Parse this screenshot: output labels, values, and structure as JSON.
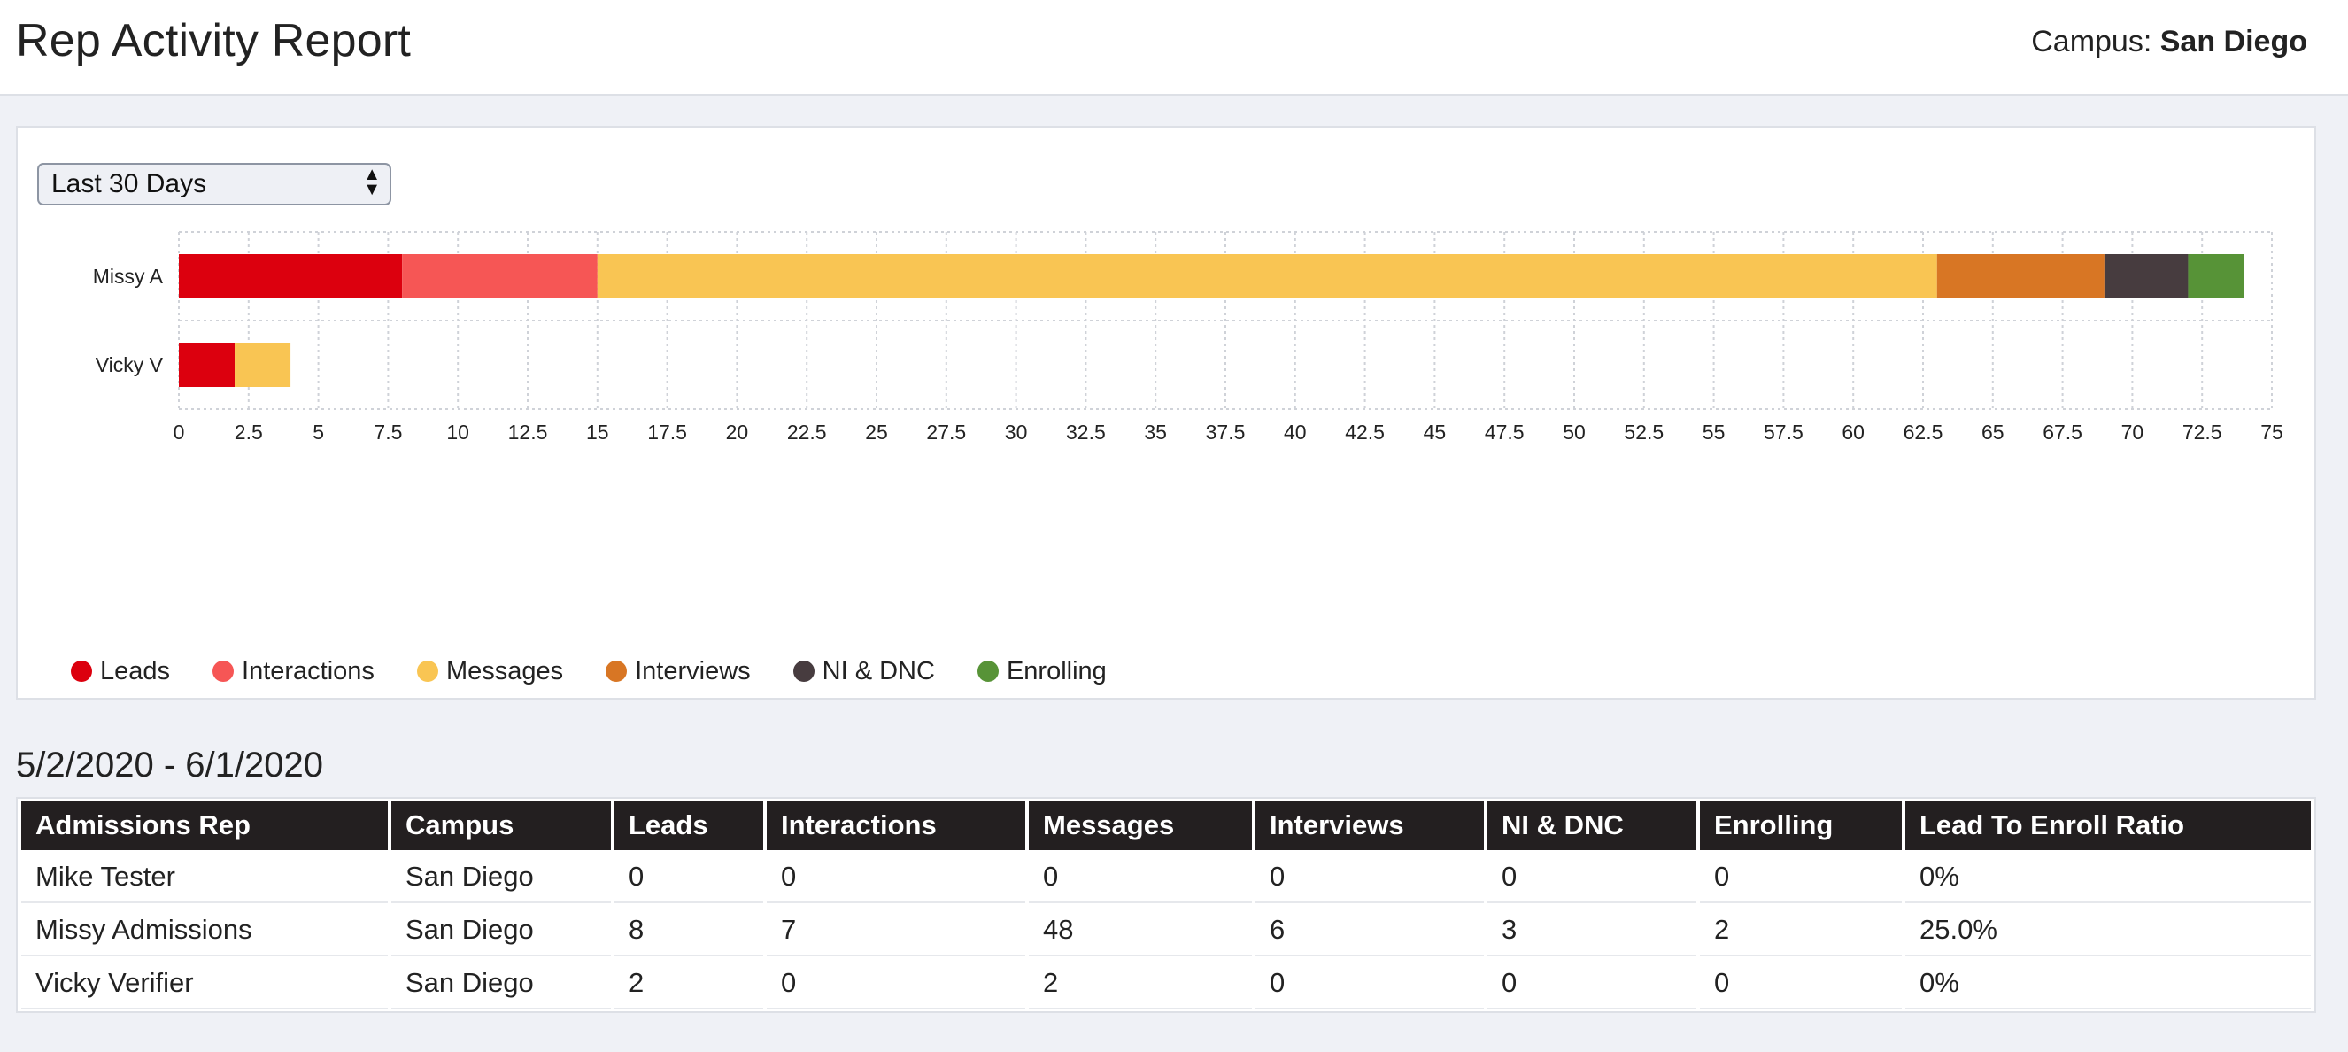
{
  "header": {
    "title": "Rep Activity Report",
    "campus_label": "Campus:",
    "campus_value": "San Diego"
  },
  "filter": {
    "selected": "Last 30 Days"
  },
  "chart_data": {
    "type": "bar",
    "orientation": "horizontal",
    "stacked": true,
    "categories": [
      "Missy A",
      "Vicky V"
    ],
    "series": [
      {
        "name": "Leads",
        "color": "#dc000e",
        "values": [
          8,
          2
        ]
      },
      {
        "name": "Interactions",
        "color": "#f65655",
        "values": [
          7,
          0
        ]
      },
      {
        "name": "Messages",
        "color": "#f9c553",
        "values": [
          48,
          2
        ]
      },
      {
        "name": "Interviews",
        "color": "#d87624",
        "values": [
          6,
          0
        ]
      },
      {
        "name": "NI & DNC",
        "color": "#473c3f",
        "values": [
          3,
          0
        ]
      },
      {
        "name": "Enrolling",
        "color": "#579337",
        "values": [
          2,
          0
        ]
      }
    ],
    "xlim": [
      0,
      75
    ],
    "xticks": [
      "0",
      "2.5",
      "5",
      "7.5",
      "10",
      "12.5",
      "15",
      "17.5",
      "20",
      "22.5",
      "25",
      "27.5",
      "30",
      "32.5",
      "35",
      "37.5",
      "40",
      "42.5",
      "45",
      "47.5",
      "50",
      "52.5",
      "55",
      "57.5",
      "60",
      "62.5",
      "65",
      "67.5",
      "70",
      "72.5",
      "75"
    ],
    "grid": true,
    "legend_position": "bottom-left"
  },
  "report": {
    "date_range": "5/2/2020 - 6/1/2020",
    "columns": [
      "Admissions Rep",
      "Campus",
      "Leads",
      "Interactions",
      "Messages",
      "Interviews",
      "NI & DNC",
      "Enrolling",
      "Lead To Enroll Ratio"
    ],
    "rows": [
      [
        "Mike Tester",
        "San Diego",
        "0",
        "0",
        "0",
        "0",
        "0",
        "0",
        "0%"
      ],
      [
        "Missy Admissions",
        "San Diego",
        "8",
        "7",
        "48",
        "6",
        "3",
        "2",
        "25.0%"
      ],
      [
        "Vicky Verifier",
        "San Diego",
        "2",
        "0",
        "2",
        "0",
        "0",
        "0",
        "0%"
      ]
    ]
  }
}
